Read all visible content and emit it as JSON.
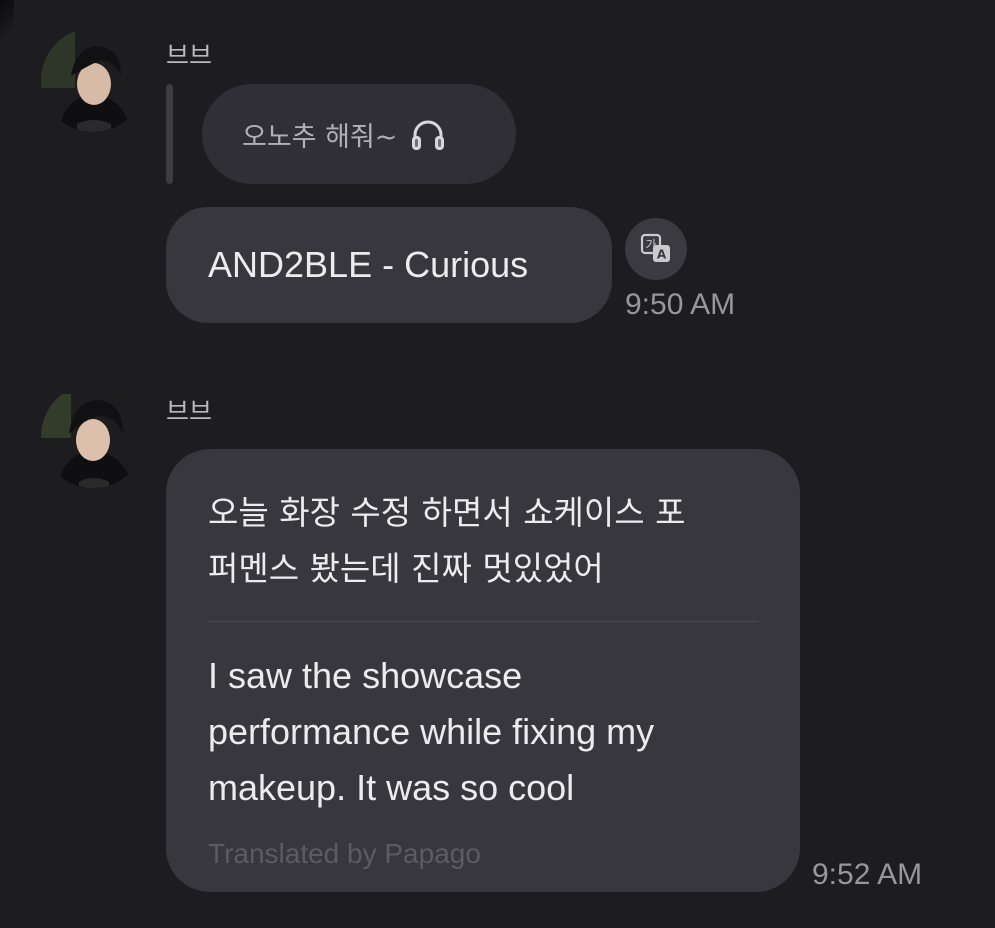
{
  "messages": [
    {
      "sender": "브브",
      "reply_to": "오노추 해줘~",
      "reply_icon": "headphones-icon",
      "text": "AND2BLE - Curious",
      "time": "9:50 AM",
      "translate_icon": "translate-icon"
    },
    {
      "sender": "브브",
      "original_text": "오늘 화장 수정 하면서 쇼케이스 포\n퍼멘스 봤는데 진짜 멋있었어",
      "translated_text": "I saw the showcase\nperformance while fixing my\nmakeup. It was so cool",
      "translation_credit": "Translated by Papago",
      "time": "9:52 AM"
    }
  ],
  "colors": {
    "background": "#1c1c21",
    "bubble": "#37373d",
    "quoted_bubble": "#2f2f35",
    "timestamp": "#96969c"
  }
}
